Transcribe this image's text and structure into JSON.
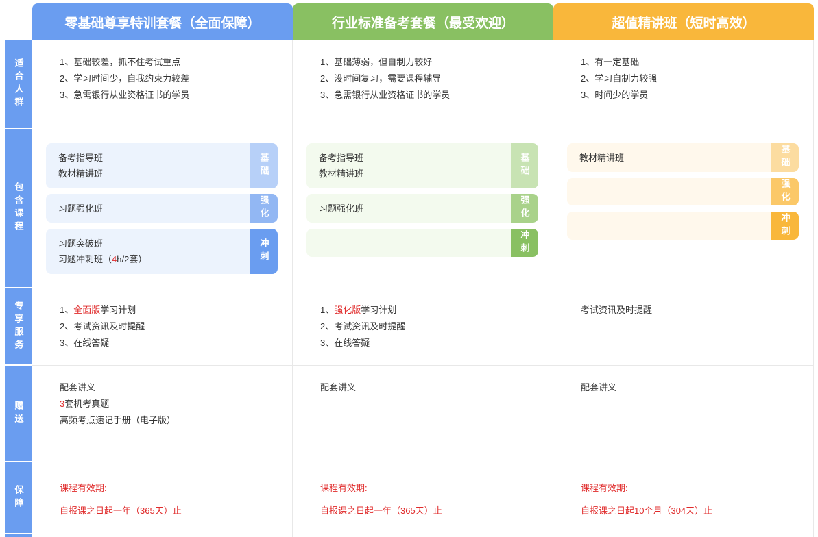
{
  "headers": [
    "零基础尊享特训套餐（全面保障）",
    "行业标准备考套餐（最受欢迎）",
    "超值精讲班（短时高效）"
  ],
  "row_labels": [
    "适合人群",
    "包含课程",
    "专享服务",
    "赠送",
    "保障"
  ],
  "suitable": [
    [
      "1、基础较差，抓不住考试重点",
      "2、学习时间少，自我约束力较差",
      "3、急需银行从业资格证书的学员"
    ],
    [
      "1、基础薄弱，但自制力较好",
      "2、没时间复习，需要课程辅导",
      "3、急需银行从业资格证书的学员"
    ],
    [
      "1、有一定基础",
      "2、学习自制力较强",
      "3、时间少的学员"
    ]
  ],
  "tags": {
    "basic": "基础",
    "strengthen": "强化",
    "sprint": "冲刺"
  },
  "courses": {
    "col1": {
      "basic": [
        "备考指导班",
        "教材精讲班"
      ],
      "strengthen": [
        "习题强化班"
      ],
      "sprint": [
        "习题突破班"
      ],
      "sprint_extra_prefix": "习题冲刺班（",
      "sprint_extra_red": "4",
      "sprint_extra_suffix": "h/2套）"
    },
    "col2": {
      "basic": [
        "备考指导班",
        "教材精讲班"
      ],
      "strengthen": [
        "习题强化班"
      ]
    },
    "col3": {
      "basic": [
        "教材精讲班"
      ]
    }
  },
  "services": {
    "col1": {
      "l1_prefix": "1、",
      "l1_red": "全面版",
      "l1_suffix": "学习计划",
      "l2": "2、考试资讯及时提醒",
      "l3": "3、在线答疑"
    },
    "col2": {
      "l1_prefix": "1、",
      "l1_red": "强化版",
      "l1_suffix": "学习计划",
      "l2": "2、考试资讯及时提醒",
      "l3": "3、在线答疑"
    },
    "col3": {
      "l1": "考试资讯及时提醒"
    }
  },
  "gifts": {
    "col1": {
      "l1": "配套讲义",
      "l2_red": "3",
      "l2_suffix": "套机考真题",
      "l3": "高频考点速记手册（电子版）"
    },
    "col2": {
      "l1": "配套讲义"
    },
    "col3": {
      "l1": "配套讲义"
    }
  },
  "guarantee": {
    "label": "课程有效期:",
    "col1": "自报课之日起一年（365天）止",
    "col2": "自报课之日起一年（365天）止",
    "col3": "自报课之日起10个月（304天）止"
  },
  "colors": {
    "blue": "#6a9df0",
    "green": "#89c062",
    "orange": "#f9b73b",
    "red": "#e02b2b"
  }
}
